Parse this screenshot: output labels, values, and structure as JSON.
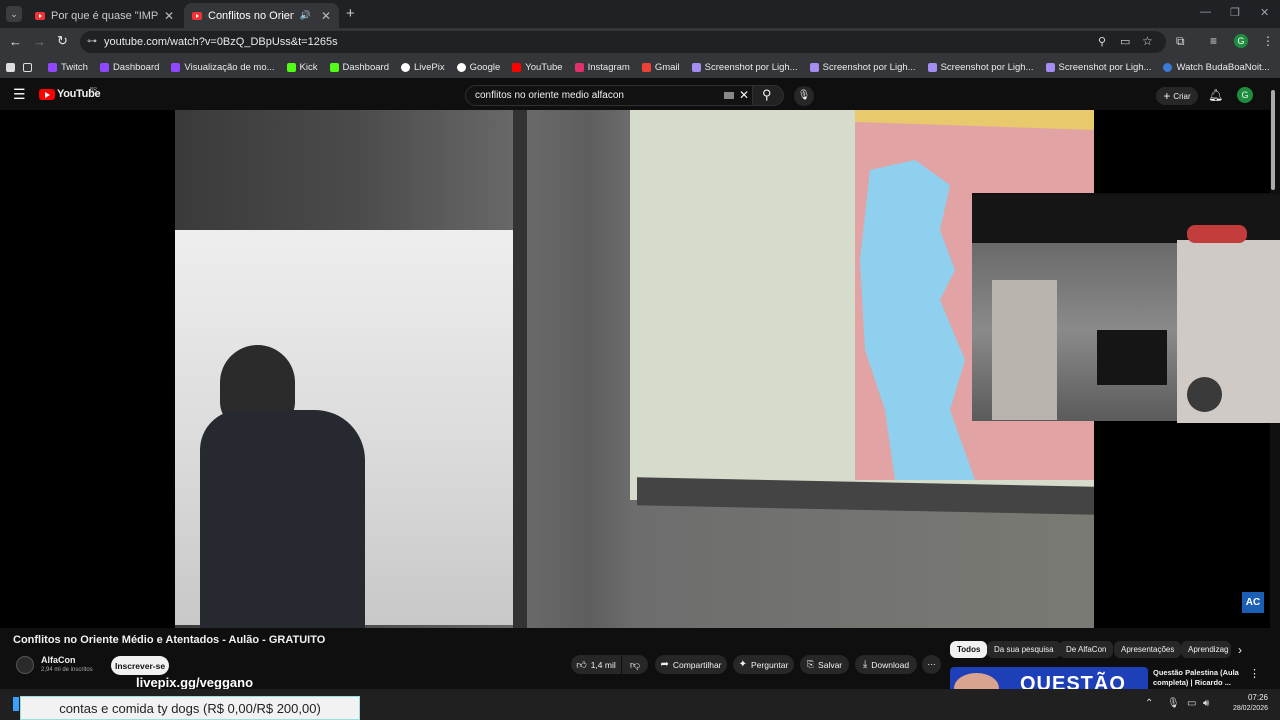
{
  "browser": {
    "tabs": [
      {
        "title": "Por que é quase \"IMPOSSÍVEL\"",
        "active": false
      },
      {
        "title": "Conflitos no Oriente Médio",
        "active": true
      }
    ],
    "url": "youtube.com/watch?v=0BzQ_DBpUss&t=1265s",
    "profile_initial": "G",
    "bookmarks": [
      "Twitch",
      "Dashboard",
      "Visualização de mo...",
      "Kick",
      "Dashboard",
      "LivePix",
      "Google",
      "YouTube",
      "Instagram",
      "Gmail",
      "Screenshot por Ligh...",
      "Screenshot por Ligh...",
      "Screenshot por Ligh...",
      "Screenshot por Ligh...",
      "Watch BudaBoaNoit..."
    ]
  },
  "youtube": {
    "logo": "YouTube",
    "logo_badge": "BR",
    "search_query": "conflitos no oriente medio alfacon",
    "create_label": "Criar",
    "avatar_initial": "G",
    "video_watermark": "AC",
    "video_title": "Conflitos no Oriente Médio e Atentados - Aulão - GRATUITO",
    "channel": {
      "name": "AlfaCon",
      "subscribers": "2,94 mi de inscritos",
      "subscribe_label": "Inscrever-se"
    },
    "actions": {
      "likes": "1,4 mil",
      "share": "Compartilhar",
      "ask": "Perguntar",
      "save": "Salvar",
      "download": "Download"
    },
    "chips": [
      "Todos",
      "Da sua pesquisa",
      "De AlfaCon",
      "Apresentações",
      "Aprendizag"
    ],
    "related": {
      "title": "Questão Palestina (Aula completa) | Ricardo ...",
      "thumb_text": "QUESTÃO"
    }
  },
  "overlay": {
    "livepix_text": "livepix.gg/veggano",
    "goal_text": "contas e comida ty dogs (R$ 0,00/R$ 200,00)"
  },
  "taskbar": {
    "time": "07:26",
    "date": "28/02/2026"
  },
  "colors": {
    "accent_red": "#ff0000",
    "chip_active_bg": "#f1f1f1",
    "profile_green": "#1e8e3e"
  }
}
